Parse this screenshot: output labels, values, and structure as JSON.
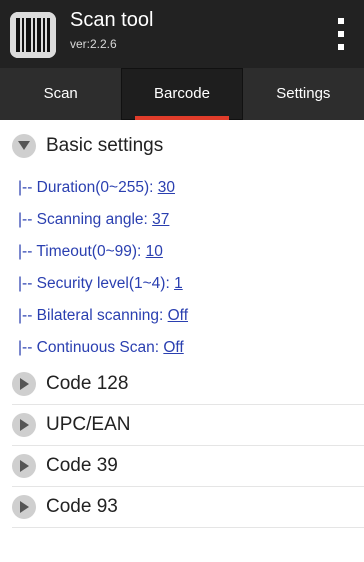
{
  "app": {
    "title": "Scan tool",
    "version": "ver:2.2.6"
  },
  "icons": {
    "app": "barcode-icon",
    "menu": "overflow-menu-icon",
    "expanded": "triangle-down-icon",
    "collapsed": "triangle-right-icon"
  },
  "tabs": [
    {
      "label": "Scan",
      "active": false
    },
    {
      "label": "Barcode",
      "active": true
    },
    {
      "label": "Settings",
      "active": false
    }
  ],
  "groups": {
    "basic": {
      "label": "Basic settings",
      "expanded": true,
      "items": [
        {
          "prefix": "|-- ",
          "label": "Duration(0~255): ",
          "value": "30"
        },
        {
          "prefix": "|-- ",
          "label": "Scanning angle: ",
          "value": "37"
        },
        {
          "prefix": "|-- ",
          "label": "Timeout(0~99): ",
          "value": "10"
        },
        {
          "prefix": "|-- ",
          "label": "Security level(1~4): ",
          "value": "1"
        },
        {
          "prefix": "|-- ",
          "label": "Bilateral scanning: ",
          "value": "Off"
        },
        {
          "prefix": "|-- ",
          "label": "Continuous Scan: ",
          "value": "Off"
        }
      ]
    },
    "code128": {
      "label": "Code 128",
      "expanded": false
    },
    "upcean": {
      "label": "UPC/EAN",
      "expanded": false
    },
    "code39": {
      "label": "Code 39",
      "expanded": false
    },
    "code93": {
      "label": "Code 93",
      "expanded": false
    }
  },
  "colors": {
    "titlebar": "#222222",
    "tabbar": "#2d2d2d",
    "tab_indicator": "#e03c2a",
    "setting_text": "#2a3fb0"
  }
}
